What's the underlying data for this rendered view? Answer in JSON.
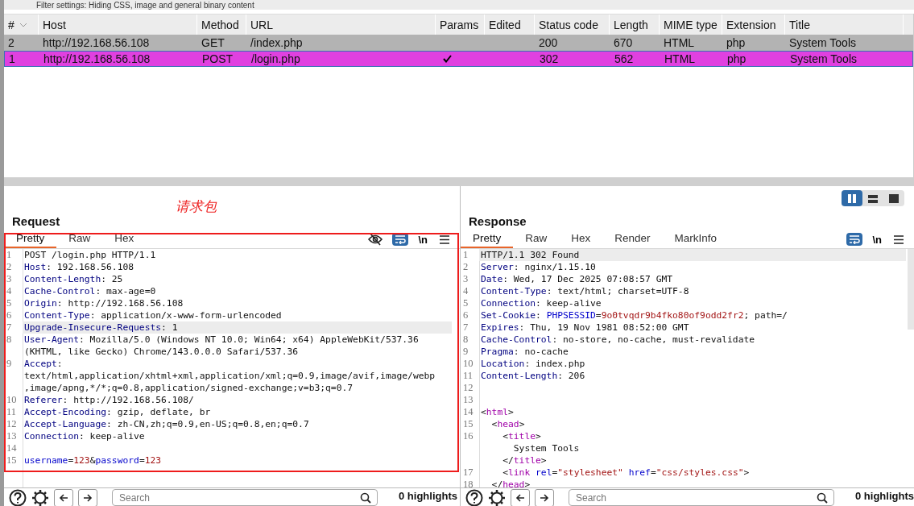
{
  "filter_bar": {
    "text": "Filter settings: Hiding CSS, image and general binary content"
  },
  "table": {
    "columns": [
      "#",
      "Host",
      "Method",
      "URL",
      "Params",
      "Edited",
      "Status code",
      "Length",
      "MIME type",
      "Extension",
      "Title"
    ],
    "rows": [
      {
        "number": "2",
        "host": "http://192.168.56.108",
        "method": "GET",
        "url": "/index.php",
        "params": false,
        "status_code": "200",
        "length": "670",
        "mime_type": "HTML",
        "extension": "php",
        "title": "System Tools",
        "selected": false,
        "color": "#b3b3b3"
      },
      {
        "number": "1",
        "host": "http://192.168.56.108",
        "method": "POST",
        "url": "/login.php",
        "params": true,
        "status_code": "302",
        "length": "562",
        "mime_type": "HTML",
        "extension": "php",
        "title": "System Tools",
        "selected": true,
        "color": "#e040e0"
      }
    ]
  },
  "layout_buttons": [
    {
      "kind": "columns",
      "selected": true
    },
    {
      "kind": "rows",
      "selected": false
    },
    {
      "kind": "single",
      "selected": false
    }
  ],
  "request": {
    "title": "Request",
    "annotation": "请求包",
    "tabs": [
      {
        "label": "Pretty",
        "selected": true
      },
      {
        "label": "Raw",
        "selected": false
      },
      {
        "label": "Hex",
        "selected": false
      }
    ],
    "toolbar": [
      {
        "kind": "hide",
        "on": false
      },
      {
        "kind": "wrap",
        "on": true
      },
      {
        "kind": "newline",
        "label": "\\n"
      },
      {
        "kind": "menu"
      }
    ],
    "lines": [
      {
        "n": "1",
        "cursor": false,
        "visual_lines": [
          {
            "parts": [
              {
                "kind": "text",
                "text": "POST /login.php HTTP/1.1"
              }
            ]
          }
        ]
      },
      {
        "n": "2",
        "cursor": false,
        "visual_lines": [
          {
            "parts": [
              {
                "kind": "key",
                "text": "Host"
              },
              {
                "kind": "text",
                "text": ": 192.168.56.108"
              }
            ]
          }
        ]
      },
      {
        "n": "3",
        "cursor": false,
        "visual_lines": [
          {
            "parts": [
              {
                "kind": "key",
                "text": "Content-Length"
              },
              {
                "kind": "text",
                "text": ": 25"
              }
            ]
          }
        ]
      },
      {
        "n": "4",
        "cursor": false,
        "visual_lines": [
          {
            "parts": [
              {
                "kind": "key",
                "text": "Cache-Control"
              },
              {
                "kind": "text",
                "text": ": max-age=0"
              }
            ]
          }
        ]
      },
      {
        "n": "5",
        "cursor": false,
        "visual_lines": [
          {
            "parts": [
              {
                "kind": "key",
                "text": "Origin"
              },
              {
                "kind": "text",
                "text": ": http://192.168.56.108"
              }
            ]
          }
        ]
      },
      {
        "n": "6",
        "cursor": false,
        "visual_lines": [
          {
            "parts": [
              {
                "kind": "key",
                "text": "Content-Type"
              },
              {
                "kind": "text",
                "text": ": application/x-www-form-urlencoded"
              }
            ]
          }
        ]
      },
      {
        "n": "7",
        "cursor": true,
        "visual_lines": [
          {
            "parts": [
              {
                "kind": "key",
                "text": "Upgrade-Insecure-Requests"
              },
              {
                "kind": "text",
                "text": ": 1"
              }
            ]
          }
        ]
      },
      {
        "n": "8",
        "cursor": false,
        "visual_lines": [
          {
            "parts": [
              {
                "kind": "key",
                "text": "User-Agent"
              },
              {
                "kind": "text",
                "text": ": Mozilla/5.0 (Windows NT 10.0; Win64; x64) AppleWebKit/537.36"
              }
            ]
          },
          {
            "parts": [
              {
                "kind": "text",
                "text": "(KHTML, like Gecko) Chrome/143.0.0.0 Safari/537.36"
              }
            ]
          }
        ]
      },
      {
        "n": "9",
        "cursor": false,
        "visual_lines": [
          {
            "parts": [
              {
                "kind": "key",
                "text": "Accept"
              },
              {
                "kind": "text",
                "text": ":"
              }
            ]
          },
          {
            "parts": [
              {
                "kind": "text",
                "text": "text/html,application/xhtml+xml,application/xml;q=0.9,image/avif,image/webp"
              }
            ]
          },
          {
            "parts": [
              {
                "kind": "text",
                "text": ",image/apng,*/*;q=0.8,application/signed-exchange;v=b3;q=0.7"
              }
            ]
          }
        ]
      },
      {
        "n": "10",
        "cursor": false,
        "visual_lines": [
          {
            "parts": [
              {
                "kind": "key",
                "text": "Referer"
              },
              {
                "kind": "text",
                "text": ": http://192.168.56.108/"
              }
            ]
          }
        ]
      },
      {
        "n": "11",
        "cursor": false,
        "visual_lines": [
          {
            "parts": [
              {
                "kind": "key",
                "text": "Accept-Encoding"
              },
              {
                "kind": "text",
                "text": ": gzip, deflate, br"
              }
            ]
          }
        ]
      },
      {
        "n": "12",
        "cursor": false,
        "visual_lines": [
          {
            "parts": [
              {
                "kind": "key",
                "text": "Accept-Language"
              },
              {
                "kind": "text",
                "text": ": zh-CN,zh;q=0.9,en-US;q=0.8,en;q=0.7"
              }
            ]
          }
        ]
      },
      {
        "n": "13",
        "cursor": false,
        "visual_lines": [
          {
            "parts": [
              {
                "kind": "key",
                "text": "Connection"
              },
              {
                "kind": "text",
                "text": ": keep-alive"
              }
            ]
          }
        ]
      },
      {
        "n": "14",
        "cursor": false
      },
      {
        "n": "15",
        "cursor": false,
        "visual_lines": [
          {
            "parts": [
              {
                "kind": "param",
                "text": "username"
              },
              {
                "kind": "text",
                "text": "="
              },
              {
                "kind": "value",
                "text": "123"
              },
              {
                "kind": "text",
                "text": "&"
              },
              {
                "kind": "param",
                "text": "password"
              },
              {
                "kind": "text",
                "text": "="
              },
              {
                "kind": "value",
                "text": "123"
              }
            ]
          }
        ]
      }
    ]
  },
  "response": {
    "title": "Response",
    "tabs": [
      {
        "label": "Pretty",
        "selected": true
      },
      {
        "label": "Raw",
        "selected": false
      },
      {
        "label": "Hex",
        "selected": false
      },
      {
        "label": "Render",
        "selected": false
      },
      {
        "label": "MarkInfo",
        "selected": false
      }
    ],
    "toolbar": [
      {
        "kind": "wrap",
        "on": true
      },
      {
        "kind": "newline",
        "label": "\\n"
      },
      {
        "kind": "menu"
      }
    ],
    "lines": [
      {
        "n": "1",
        "cursor": true,
        "visual_lines": [
          {
            "parts": [
              {
                "kind": "text",
                "text": "HTTP/1.1 302 Found"
              }
            ]
          }
        ]
      },
      {
        "n": "2",
        "cursor": false,
        "visual_lines": [
          {
            "parts": [
              {
                "kind": "key",
                "text": "Server"
              },
              {
                "kind": "text",
                "text": ": nginx/1.15.10"
              }
            ]
          }
        ]
      },
      {
        "n": "3",
        "cursor": false,
        "visual_lines": [
          {
            "parts": [
              {
                "kind": "key",
                "text": "Date"
              },
              {
                "kind": "text",
                "text": ": Wed, 17 Dec 2025 07:08:57 GMT"
              }
            ]
          }
        ]
      },
      {
        "n": "4",
        "cursor": false,
        "visual_lines": [
          {
            "parts": [
              {
                "kind": "key",
                "text": "Content-Type"
              },
              {
                "kind": "text",
                "text": ": text/html; charset=UTF-8"
              }
            ]
          }
        ]
      },
      {
        "n": "5",
        "cursor": false,
        "visual_lines": [
          {
            "parts": [
              {
                "kind": "key",
                "text": "Connection"
              },
              {
                "kind": "text",
                "text": ": keep-alive"
              }
            ]
          }
        ]
      },
      {
        "n": "6",
        "cursor": false,
        "visual_lines": [
          {
            "parts": [
              {
                "kind": "key",
                "text": "Set-Cookie"
              },
              {
                "kind": "text",
                "text": ": "
              },
              {
                "kind": "param",
                "text": "PHPSESSID"
              },
              {
                "kind": "text",
                "text": "="
              },
              {
                "kind": "value",
                "text": "9o0tvqdr9b4fko80of9odd2fr2"
              },
              {
                "kind": "text",
                "text": "; path=/"
              }
            ]
          }
        ]
      },
      {
        "n": "7",
        "cursor": false,
        "visual_lines": [
          {
            "parts": [
              {
                "kind": "key",
                "text": "Expires"
              },
              {
                "kind": "text",
                "text": ": Thu, 19 Nov 1981 08:52:00 GMT"
              }
            ]
          }
        ]
      },
      {
        "n": "8",
        "cursor": false,
        "visual_lines": [
          {
            "parts": [
              {
                "kind": "key",
                "text": "Cache-Control"
              },
              {
                "kind": "text",
                "text": ": no-store, no-cache, must-revalidate"
              }
            ]
          }
        ]
      },
      {
        "n": "9",
        "cursor": false,
        "visual_lines": [
          {
            "parts": [
              {
                "kind": "key",
                "text": "Pragma"
              },
              {
                "kind": "text",
                "text": ": no-cache"
              }
            ]
          }
        ]
      },
      {
        "n": "10",
        "cursor": false,
        "visual_lines": [
          {
            "parts": [
              {
                "kind": "key",
                "text": "Location"
              },
              {
                "kind": "text",
                "text": ": index.php"
              }
            ]
          }
        ]
      },
      {
        "n": "11",
        "cursor": false,
        "visual_lines": [
          {
            "parts": [
              {
                "kind": "key",
                "text": "Content-Length"
              },
              {
                "kind": "text",
                "text": ": 206"
              }
            ]
          }
        ]
      },
      {
        "n": "12",
        "cursor": false
      },
      {
        "n": "13",
        "cursor": false
      },
      {
        "n": "14",
        "cursor": false,
        "visual_lines": [
          {
            "parts": [
              {
                "kind": "text",
                "text": "<"
              },
              {
                "kind": "tag",
                "text": "html"
              },
              {
                "kind": "text",
                "text": ">"
              }
            ]
          }
        ]
      },
      {
        "n": "15",
        "cursor": false,
        "visual_lines": [
          {
            "parts": [
              {
                "kind": "text",
                "text": "  <"
              },
              {
                "kind": "tag",
                "text": "head"
              },
              {
                "kind": "text",
                "text": ">"
              }
            ]
          }
        ]
      },
      {
        "n": "16",
        "cursor": false,
        "visual_lines": [
          {
            "parts": [
              {
                "kind": "text",
                "text": "    <"
              },
              {
                "kind": "tag",
                "text": "title"
              },
              {
                "kind": "text",
                "text": ">"
              }
            ]
          },
          {
            "parts": [
              {
                "kind": "text",
                "text": "      System Tools"
              }
            ]
          },
          {
            "parts": [
              {
                "kind": "text",
                "text": "    </"
              },
              {
                "kind": "tag",
                "text": "title"
              },
              {
                "kind": "text",
                "text": ">"
              }
            ]
          }
        ]
      },
      {
        "n": "17",
        "cursor": false,
        "visual_lines": [
          {
            "parts": [
              {
                "kind": "text",
                "text": "    <"
              },
              {
                "kind": "tag",
                "text": "link"
              },
              {
                "kind": "attr",
                "text": " rel"
              },
              {
                "kind": "text",
                "text": "="
              },
              {
                "kind": "value",
                "text": "\"stylesheet\""
              },
              {
                "kind": "attr",
                "text": " href"
              },
              {
                "kind": "text",
                "text": "="
              },
              {
                "kind": "value",
                "text": "\"css/styles.css\""
              },
              {
                "kind": "text",
                "text": ">"
              }
            ]
          }
        ]
      },
      {
        "n": "18",
        "cursor": false,
        "visual_lines": [
          {
            "parts": [
              {
                "kind": "text",
                "text": "  </"
              },
              {
                "kind": "tag",
                "text": "head"
              },
              {
                "kind": "text",
                "text": ">"
              }
            ]
          }
        ]
      }
    ]
  },
  "bottom_bars": [
    {
      "placeholder": "Search",
      "highlights": "0 highlights"
    },
    {
      "placeholder": "Search",
      "highlights": "0 highlights"
    }
  ]
}
